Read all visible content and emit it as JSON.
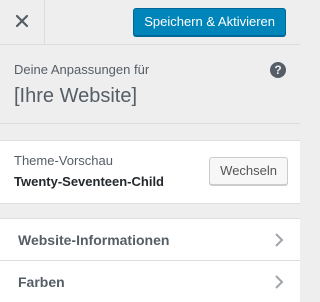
{
  "header": {
    "close_icon": "close-icon",
    "save_label": "Speichern & Aktivieren"
  },
  "info": {
    "label": "Deine Anpassungen für",
    "title": "[Ihre Website]",
    "help_glyph": "?"
  },
  "theme": {
    "label": "Theme-Vorschau",
    "name": "Twenty-Seventeen-Child",
    "change_label": "Wechseln"
  },
  "nav": {
    "items": [
      {
        "label": "Website-Informationen",
        "icon": "chevron-right-icon"
      },
      {
        "label": "Farben",
        "icon": "chevron-right-icon"
      }
    ]
  },
  "colors": {
    "primary": "#0085ba",
    "background": "#eeeeee",
    "text": "#555d66"
  }
}
